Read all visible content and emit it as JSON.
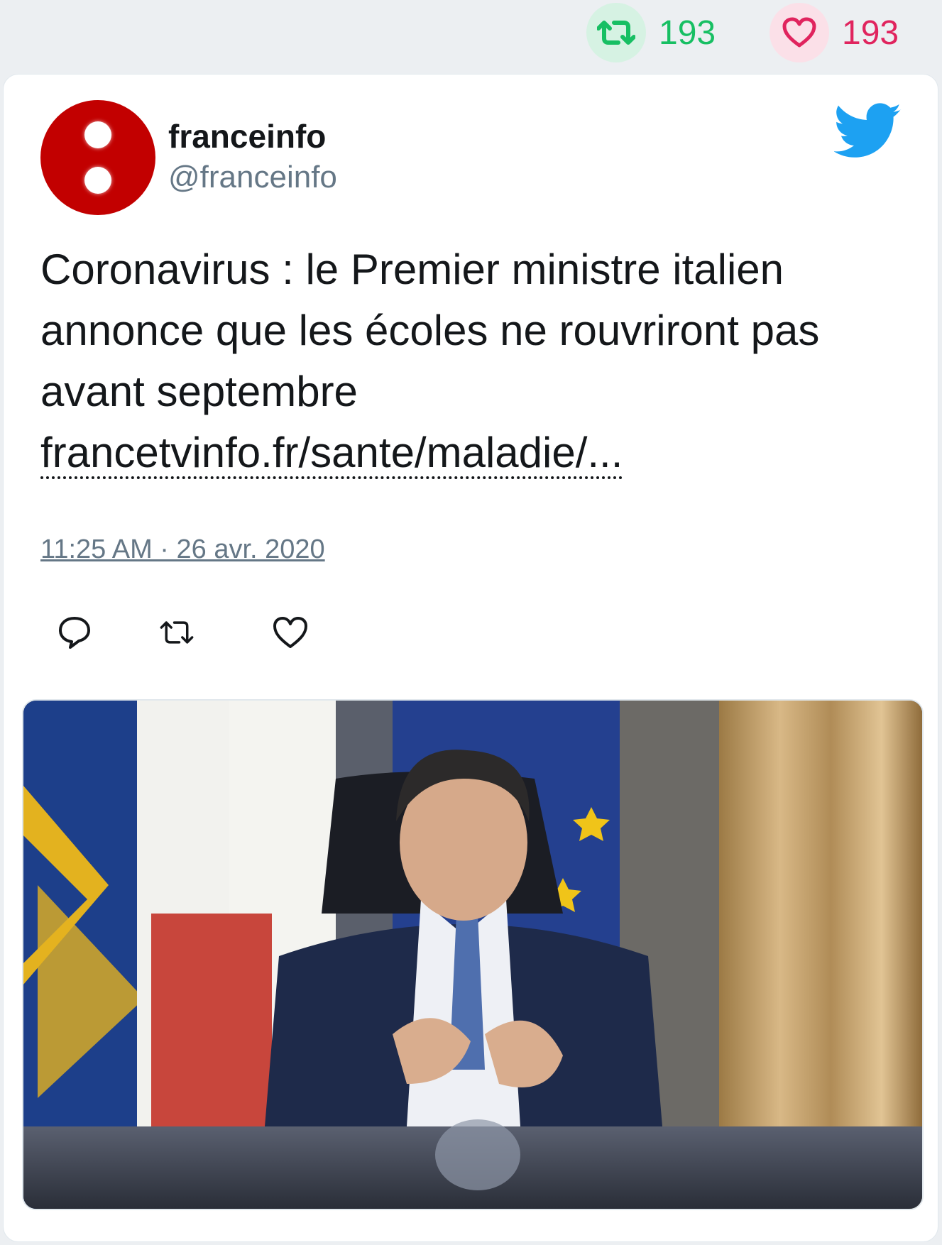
{
  "stats": {
    "retweets": "193",
    "likes": "193"
  },
  "tweet": {
    "name": "franceinfo",
    "handle": "@franceinfo",
    "text": "Coronavirus : le Premier ministre italien annonce que les écoles ne rouvriront pas avant septembre ",
    "link": "francetvinfo.fr/sante/maladie/...",
    "timestamp": "11:25 AM · 26 avr. 2020"
  },
  "icons": {
    "stat_retweet": "retweet-icon",
    "stat_like": "heart-icon",
    "brand": "twitter-bird-icon",
    "reply": "reply-icon",
    "retweet": "retweet-icon",
    "like": "heart-icon"
  },
  "colors": {
    "retweet": "#17bf63",
    "like": "#e0245e",
    "twitter_blue": "#1da1f2",
    "avatar": "#c20000"
  }
}
